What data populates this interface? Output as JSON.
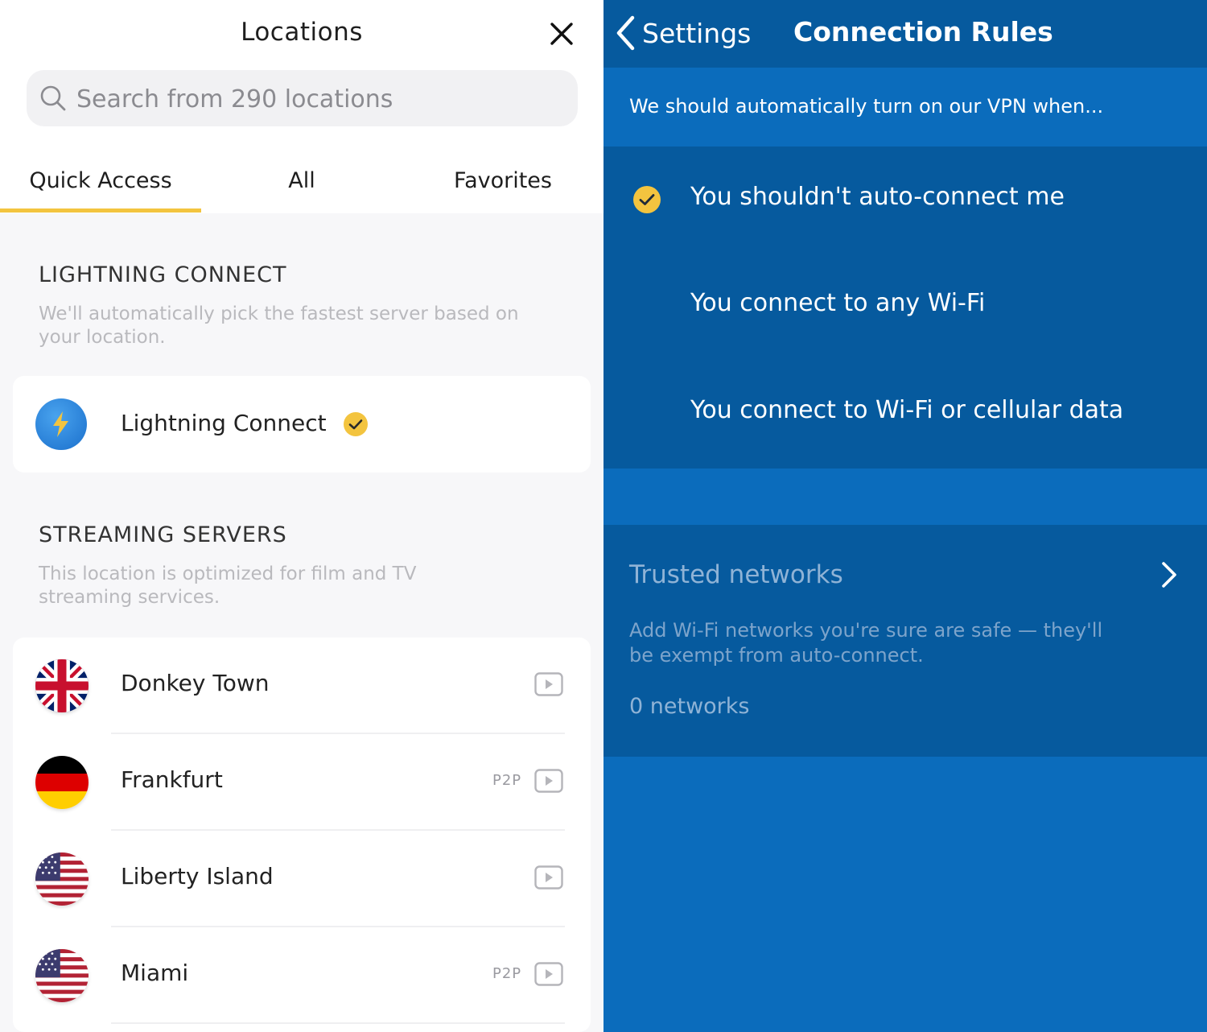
{
  "locations": {
    "title": "Locations",
    "search_placeholder": "Search from 290 locations",
    "tabs": [
      {
        "label": "Quick Access",
        "active": true
      },
      {
        "label": "All",
        "active": false
      },
      {
        "label": "Favorites",
        "active": false
      }
    ],
    "accent_color": "#f3c43f",
    "lightning": {
      "section_title": "LIGHTNING CONNECT",
      "section_desc": "We'll automatically pick the fastest server based on your location.",
      "item_label": "Lightning Connect",
      "selected": true
    },
    "streaming": {
      "section_title": "STREAMING SERVERS",
      "section_desc": "This location is optimized for film and TV streaming services.",
      "servers": [
        {
          "name": "Donkey Town",
          "flag": "uk",
          "p2p": ""
        },
        {
          "name": "Frankfurt",
          "flag": "germany",
          "p2p": "P2P"
        },
        {
          "name": "Liberty Island",
          "flag": "usa",
          "p2p": ""
        },
        {
          "name": "Miami",
          "flag": "usa",
          "p2p": "P2P"
        }
      ]
    }
  },
  "connection_rules": {
    "back_label": "Settings",
    "title": "Connection Rules",
    "intro": "We should automatically turn on our VPN when...",
    "options": [
      {
        "label": "You shouldn't auto-connect me",
        "selected": true
      },
      {
        "label": "You connect to any Wi-Fi",
        "selected": false
      },
      {
        "label": "You connect to Wi-Fi or cellular data",
        "selected": false
      }
    ],
    "trusted": {
      "title": "Trusted networks",
      "desc": "Add Wi-Fi networks you're sure are safe — they'll be exempt from auto-connect.",
      "count": "0 networks"
    },
    "colors": {
      "background": "#0b6cbc",
      "band": "#065a9e",
      "check": "#f3c43f"
    }
  }
}
